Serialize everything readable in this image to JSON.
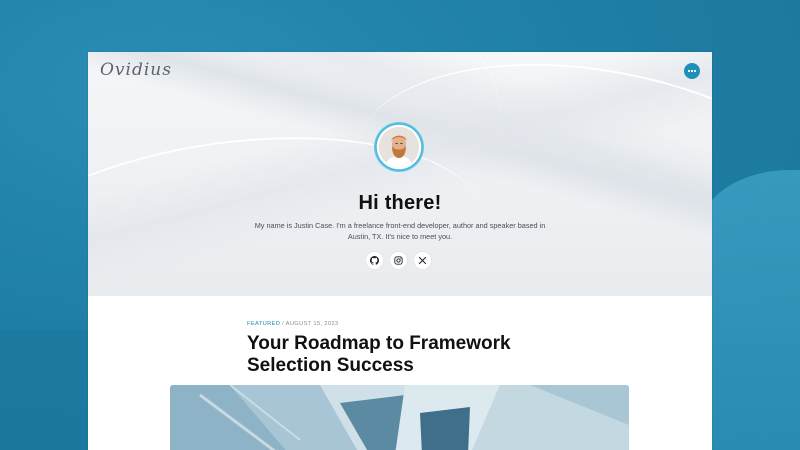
{
  "site": {
    "logo_text": "Ovidius",
    "menu_icon": "more-horizontal-icon",
    "accent_color": "#1e8fb8"
  },
  "hero": {
    "heading": "Hi there!",
    "intro": "My name is Justin Case. I'm a freelance front-end developer, author and speaker based in Austin, TX. It's nice to meet you.",
    "avatar_alt": "Justin Case",
    "socials": [
      {
        "name": "github",
        "icon": "github-icon"
      },
      {
        "name": "instagram",
        "icon": "instagram-icon"
      },
      {
        "name": "x",
        "icon": "x-icon"
      }
    ]
  },
  "featured_post": {
    "category": "FEATURED",
    "separator": "/",
    "date": "AUGUST 15, 2023",
    "title": "Your Roadmap to Framework Selection Success"
  }
}
